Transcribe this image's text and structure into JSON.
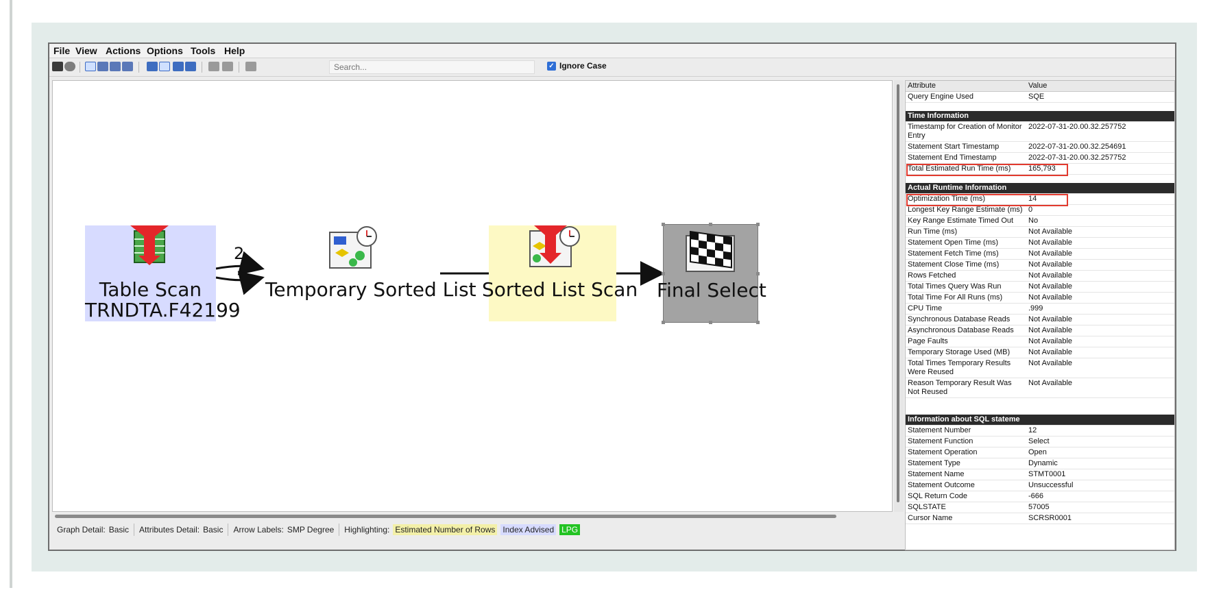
{
  "menu": [
    "File",
    "View",
    "Actions",
    "Options",
    "Tools",
    "Help"
  ],
  "toolbar": {
    "search_placeholder": "Search...",
    "ignore_case_label": "Ignore Case"
  },
  "graph": {
    "nodes": [
      {
        "label_line1": "Table Scan",
        "label_line2": "TRNDTA.F42199",
        "icon": "table-scan-icon",
        "highlight": "#d7dbff"
      },
      {
        "label_line1": "Temporary Sorted List",
        "icon": "temporary-sorted-list-icon"
      },
      {
        "label_line1": "Sorted List Scan",
        "icon": "sorted-list-scan-icon",
        "highlight": "#fdf9c4"
      },
      {
        "label_line1": "Final Select",
        "icon": "final-select-icon",
        "highlight": "#a3a3a3"
      }
    ],
    "arrow_label": "2"
  },
  "status": {
    "graph_detail_label": "Graph Detail:",
    "graph_detail_value": "Basic",
    "attributes_detail_label": "Attributes Detail:",
    "attributes_detail_value": "Basic",
    "arrow_labels_label": "Arrow Labels:",
    "arrow_labels_value": "SMP Degree",
    "highlighting_label": "Highlighting:",
    "legend": [
      {
        "label": "Estimated Number of Rows",
        "color": "#f3f0a8"
      },
      {
        "label": "Index Advised",
        "color": "#d7dbff"
      },
      {
        "label": "LPG",
        "color": "#22c322"
      }
    ]
  },
  "attributes": {
    "header": {
      "attribute": "Attribute",
      "value": "Value"
    },
    "rows": [
      {
        "type": "row",
        "a": "Query Engine Used",
        "v": "SQE"
      },
      {
        "type": "gap"
      },
      {
        "type": "section",
        "a": "Time Information",
        "v": ""
      },
      {
        "type": "row",
        "a": "Timestamp for Creation of Monitor Entry",
        "v": "2022-07-31-20.00.32.257752"
      },
      {
        "type": "row",
        "a": "Statement Start Timestamp",
        "v": "2022-07-31-20.00.32.254691"
      },
      {
        "type": "row",
        "a": "Statement End Timestamp",
        "v": "2022-07-31-20.00.32.257752"
      },
      {
        "type": "row",
        "a": "Total Estimated Run Time (ms)",
        "v": "165,793",
        "mark": "runtime"
      },
      {
        "type": "gap"
      },
      {
        "type": "section",
        "a": "Actual Runtime Information",
        "v": ""
      },
      {
        "type": "row",
        "a": "Optimization Time (ms)",
        "v": "14",
        "mark": "opt"
      },
      {
        "type": "row",
        "a": "Longest Key Range Estimate (ms)",
        "v": "0"
      },
      {
        "type": "row",
        "a": "Key Range Estimate Timed Out",
        "v": "No"
      },
      {
        "type": "row",
        "a": "Run Time (ms)",
        "v": "Not Available"
      },
      {
        "type": "row",
        "a": "Statement Open Time (ms)",
        "v": "Not Available"
      },
      {
        "type": "row",
        "a": "Statement Fetch Time (ms)",
        "v": "Not Available"
      },
      {
        "type": "row",
        "a": "Statement Close Time (ms)",
        "v": "Not Available"
      },
      {
        "type": "row",
        "a": "Rows Fetched",
        "v": "Not Available"
      },
      {
        "type": "row",
        "a": "Total Times Query Was Run",
        "v": "Not Available"
      },
      {
        "type": "row",
        "a": "Total Time For All Runs (ms)",
        "v": "Not Available"
      },
      {
        "type": "row",
        "a": "CPU Time",
        "v": ".999"
      },
      {
        "type": "row",
        "a": "Synchronous Database Reads",
        "v": "Not Available"
      },
      {
        "type": "row",
        "a": "Asynchronous Database Reads",
        "v": "Not Available"
      },
      {
        "type": "row",
        "a": "Page Faults",
        "v": "Not Available"
      },
      {
        "type": "row",
        "a": "Temporary Storage Used (MB)",
        "v": "Not Available"
      },
      {
        "type": "row",
        "a": "Total Times Temporary Results Were Reused",
        "v": "Not Available"
      },
      {
        "type": "row",
        "a": "Reason Temporary Result Was Not Reused",
        "v": "Not Available"
      },
      {
        "type": "gap"
      },
      {
        "type": "gap"
      },
      {
        "type": "section",
        "a": "Information about SQL stateme",
        "v": ""
      },
      {
        "type": "row",
        "a": "Statement Number",
        "v": "12"
      },
      {
        "type": "row",
        "a": "Statement Function",
        "v": "Select"
      },
      {
        "type": "row",
        "a": "Statement Operation",
        "v": "Open"
      },
      {
        "type": "row",
        "a": "Statement Type",
        "v": "Dynamic"
      },
      {
        "type": "row",
        "a": "Statement Name",
        "v": "STMT0001"
      },
      {
        "type": "row",
        "a": "Statement Outcome",
        "v": "Unsuccessful"
      },
      {
        "type": "row",
        "a": "SQL Return Code",
        "v": "-666"
      },
      {
        "type": "row",
        "a": "SQLSTATE",
        "v": "57005"
      },
      {
        "type": "row",
        "a": "Cursor Name",
        "v": "SCRSR0001"
      }
    ]
  }
}
